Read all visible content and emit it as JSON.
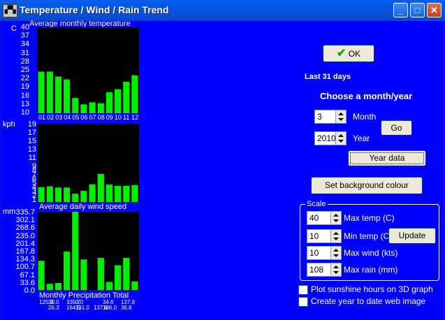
{
  "window": {
    "title": "Temperature / Wind / Rain Trend",
    "minimize_label": "_",
    "maximize_label": "□",
    "close_label": "✕"
  },
  "colors": {
    "bar": "#00ee00",
    "plot_bg": "#000000",
    "client_bg": "#0000ff"
  },
  "charts": {
    "temperature": {
      "title": "Average monthly temperature",
      "unit_label": "C",
      "ticks": [
        "40",
        "37",
        "34",
        "31",
        "28",
        "25",
        "22",
        "19",
        "16",
        "13",
        "10"
      ],
      "months": [
        "01",
        "02",
        "03",
        "04",
        "05",
        "06",
        "07",
        "08",
        "09",
        "10",
        "11",
        "12"
      ]
    },
    "wind": {
      "title": "Average daily wind speed",
      "unit_label": "kph",
      "ticks": [
        "19",
        "17",
        "15",
        "13",
        "11",
        "9",
        "7",
        "5",
        "3",
        "1"
      ],
      "extra_ticks": [
        "8",
        "6",
        "4",
        "2"
      ]
    },
    "rain": {
      "title": "Monthly Precipitation Total",
      "unit_label": "mm",
      "ticks": [
        "335.7",
        "302.1",
        "268.6",
        "235.0",
        "201.4",
        "167.8",
        "134.3",
        "100.7",
        "67.1",
        "33.6",
        "0.0"
      ],
      "labels_top": [
        "125.3",
        "30.0",
        "",
        "335.7",
        "0.0",
        "",
        "",
        "34.6",
        "",
        "137.8",
        ""
      ],
      "labels_bottom": [
        "",
        "26.3",
        "",
        "164.5",
        "131.0",
        "",
        "137.6",
        "106.0",
        "",
        "36.8",
        ""
      ]
    }
  },
  "chart_data": [
    {
      "type": "bar",
      "title": "Average monthly temperature",
      "ylabel": "C",
      "categories": [
        "01",
        "02",
        "03",
        "04",
        "05",
        "06",
        "07",
        "08",
        "09",
        "10",
        "11",
        "12"
      ],
      "values": [
        24.5,
        24.5,
        22.8,
        21.8,
        15.3,
        13.1,
        13.8,
        13.5,
        17.3,
        18.4,
        21.0,
        23.2
      ],
      "ylim": [
        10,
        40
      ]
    },
    {
      "type": "bar",
      "title": "Average daily wind speed",
      "ylabel": "kph",
      "categories": [
        "01",
        "02",
        "03",
        "04",
        "05",
        "06",
        "07",
        "08",
        "09",
        "10",
        "11",
        "12"
      ],
      "values": [
        3.6,
        3.8,
        3.5,
        3.5,
        2.0,
        2.7,
        4.3,
        6.8,
        4.2,
        3.9,
        3.9,
        4.1
      ],
      "ylim": [
        0,
        19
      ]
    },
    {
      "type": "bar",
      "title": "Monthly Precipitation Total",
      "ylabel": "mm",
      "categories": [
        "01",
        "02",
        "03",
        "04",
        "05",
        "06",
        "07",
        "08",
        "09",
        "10",
        "11",
        "12"
      ],
      "values": [
        125.3,
        26.3,
        30.0,
        164.5,
        335.7,
        131.0,
        0.0,
        137.6,
        34.6,
        106.0,
        137.8,
        36.8
      ],
      "ylim": [
        0,
        335.7
      ]
    }
  ],
  "controls": {
    "ok_label": "OK",
    "period_label": "Last 31 days",
    "choose_label": "Choose a month/year",
    "month_value": "3",
    "month_label": "Month",
    "year_value": "2010",
    "year_label": "Year",
    "go_label": "Go",
    "year_data_label": "Year data",
    "bg_colour_label": "Set background colour",
    "scale_label": "Scale",
    "max_temp_value": "40",
    "max_temp_label": "Max temp (C)",
    "min_temp_value": "10",
    "min_temp_label": "Min temp (C)",
    "update_label": "Update",
    "max_wind_value": "10",
    "max_wind_label": "Max wind (kts)",
    "max_rain_value": "108",
    "max_rain_label": "Max rain (mm)",
    "sunshine_label": "Plot sunshine hours on 3D graph",
    "web_image_label": "Create year to date web image"
  }
}
